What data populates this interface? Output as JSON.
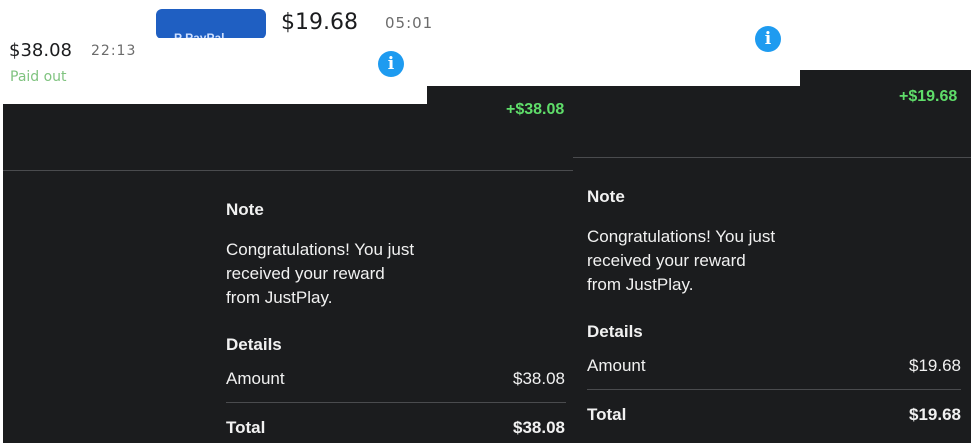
{
  "left": {
    "amount": "$38.08",
    "time": "22:13",
    "status": "Paid out",
    "credit": "+$38.08",
    "note_heading": "Note",
    "note_lines": [
      "Congratulations! You just",
      "received your reward",
      "from JustPlay."
    ],
    "details_heading": "Details",
    "amount_label": "Amount",
    "amount_value": "$38.08",
    "total_label": "Total",
    "total_value": "$38.08"
  },
  "right": {
    "amount": "$19.68",
    "time": "05:01",
    "credit": "+$19.68",
    "note_heading": "Note",
    "note_lines": [
      "Congratulations! You just",
      "received your reward",
      "from JustPlay."
    ],
    "details_heading": "Details",
    "amount_label": "Amount",
    "amount_value": "$19.68",
    "total_label": "Total",
    "total_value": "$19.68"
  },
  "icons": {
    "info": "info-icon",
    "logo": "paypal-logo"
  },
  "colors": {
    "dark_bg": "#1b1c1e",
    "credit_green": "#5fdd6a",
    "info_blue": "#1e9bf0",
    "paid_green": "#7fc37f"
  }
}
